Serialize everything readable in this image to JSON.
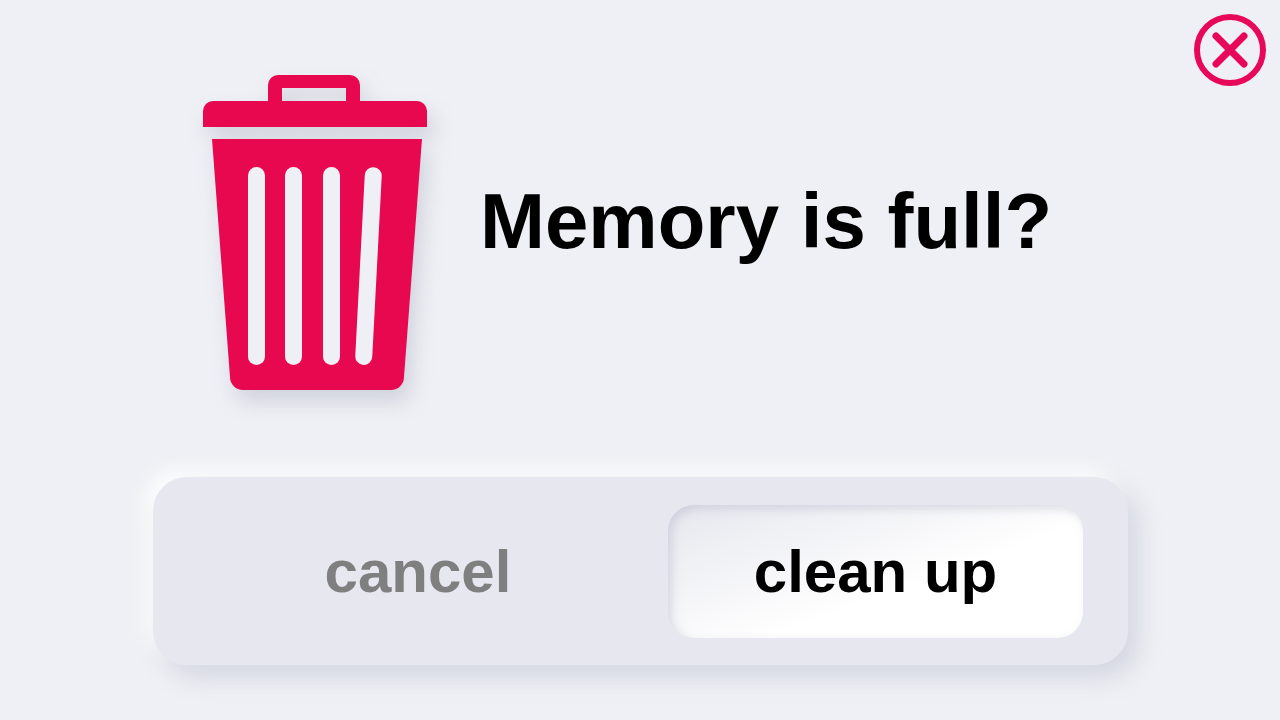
{
  "title": "Memory is full?",
  "options": [
    {
      "label": "cancel",
      "selected": false
    },
    {
      "label": "clean up",
      "selected": true
    }
  ]
}
